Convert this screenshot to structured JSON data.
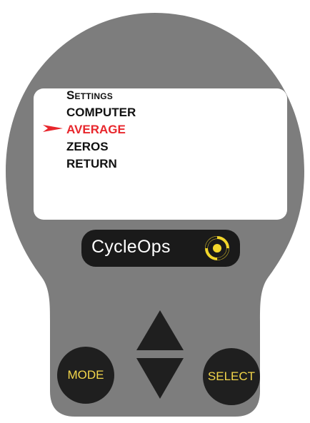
{
  "menu": {
    "title": "Settings",
    "items": [
      {
        "label": "COMPUTER",
        "selected": false
      },
      {
        "label": "AVERAGE",
        "selected": true
      },
      {
        "label": "ZEROS",
        "selected": false
      },
      {
        "label": "RETURN",
        "selected": false
      }
    ]
  },
  "brand": {
    "logo_text": "CycleOps"
  },
  "buttons": {
    "mode_label": "MODE",
    "select_label": "SELECT",
    "up_icon": "triangle-up-icon",
    "down_icon": "triangle-down-icon"
  },
  "colors": {
    "body": "#7d7d7d",
    "screen": "#ffffff",
    "selected_text": "#e8262c",
    "button": "#1f1f1f",
    "button_label": "#f3d64a",
    "logo_accent": "#f2d62b"
  }
}
